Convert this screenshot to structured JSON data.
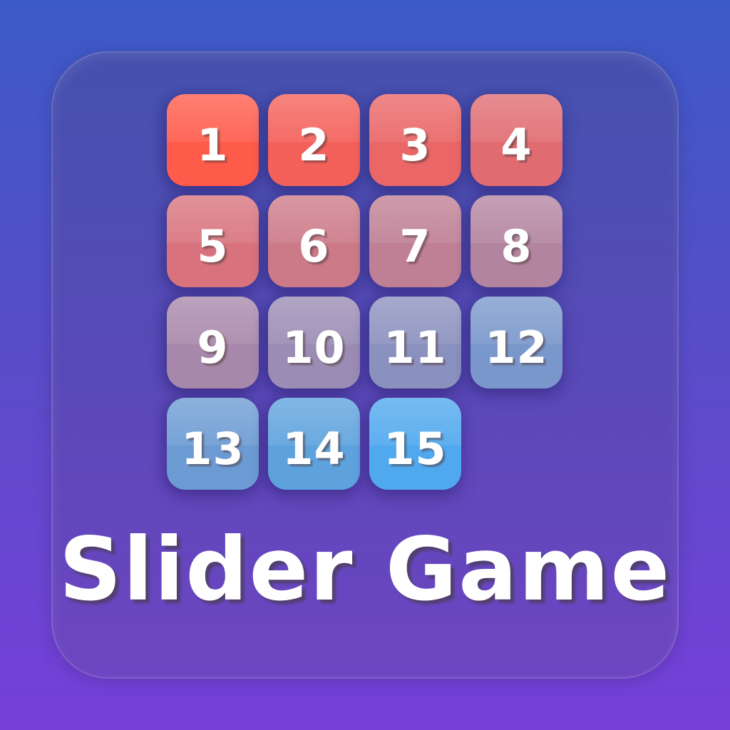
{
  "title": "Slider Game",
  "board": {
    "rows": 4,
    "cols": 4,
    "tiles": [
      {
        "label": "1",
        "row": 0,
        "col": 0,
        "color": "#ff5b4b"
      },
      {
        "label": "2",
        "row": 0,
        "col": 1,
        "color": "#f4615a"
      },
      {
        "label": "3",
        "row": 0,
        "col": 2,
        "color": "#ea6667"
      },
      {
        "label": "4",
        "row": 0,
        "col": 3,
        "color": "#e06c72"
      },
      {
        "label": "5",
        "row": 1,
        "col": 0,
        "color": "#d8737d"
      },
      {
        "label": "6",
        "row": 1,
        "col": 1,
        "color": "#cc7a88"
      },
      {
        "label": "7",
        "row": 1,
        "col": 2,
        "color": "#bf7f95"
      },
      {
        "label": "8",
        "row": 1,
        "col": 3,
        "color": "#b384a0"
      },
      {
        "label": "9",
        "row": 2,
        "col": 0,
        "color": "#a888aa"
      },
      {
        "label": "10",
        "row": 2,
        "col": 1,
        "color": "#9a8cb4"
      },
      {
        "label": "11",
        "row": 2,
        "col": 2,
        "color": "#8b91bf"
      },
      {
        "label": "12",
        "row": 2,
        "col": 3,
        "color": "#7a97cb"
      },
      {
        "label": "13",
        "row": 3,
        "col": 0,
        "color": "#6c9bd3"
      },
      {
        "label": "14",
        "row": 3,
        "col": 1,
        "color": "#5ea2dd"
      },
      {
        "label": "15",
        "row": 3,
        "col": 2,
        "color": "#50a8ee"
      }
    ],
    "empty": {
      "row": 3,
      "col": 3
    }
  }
}
